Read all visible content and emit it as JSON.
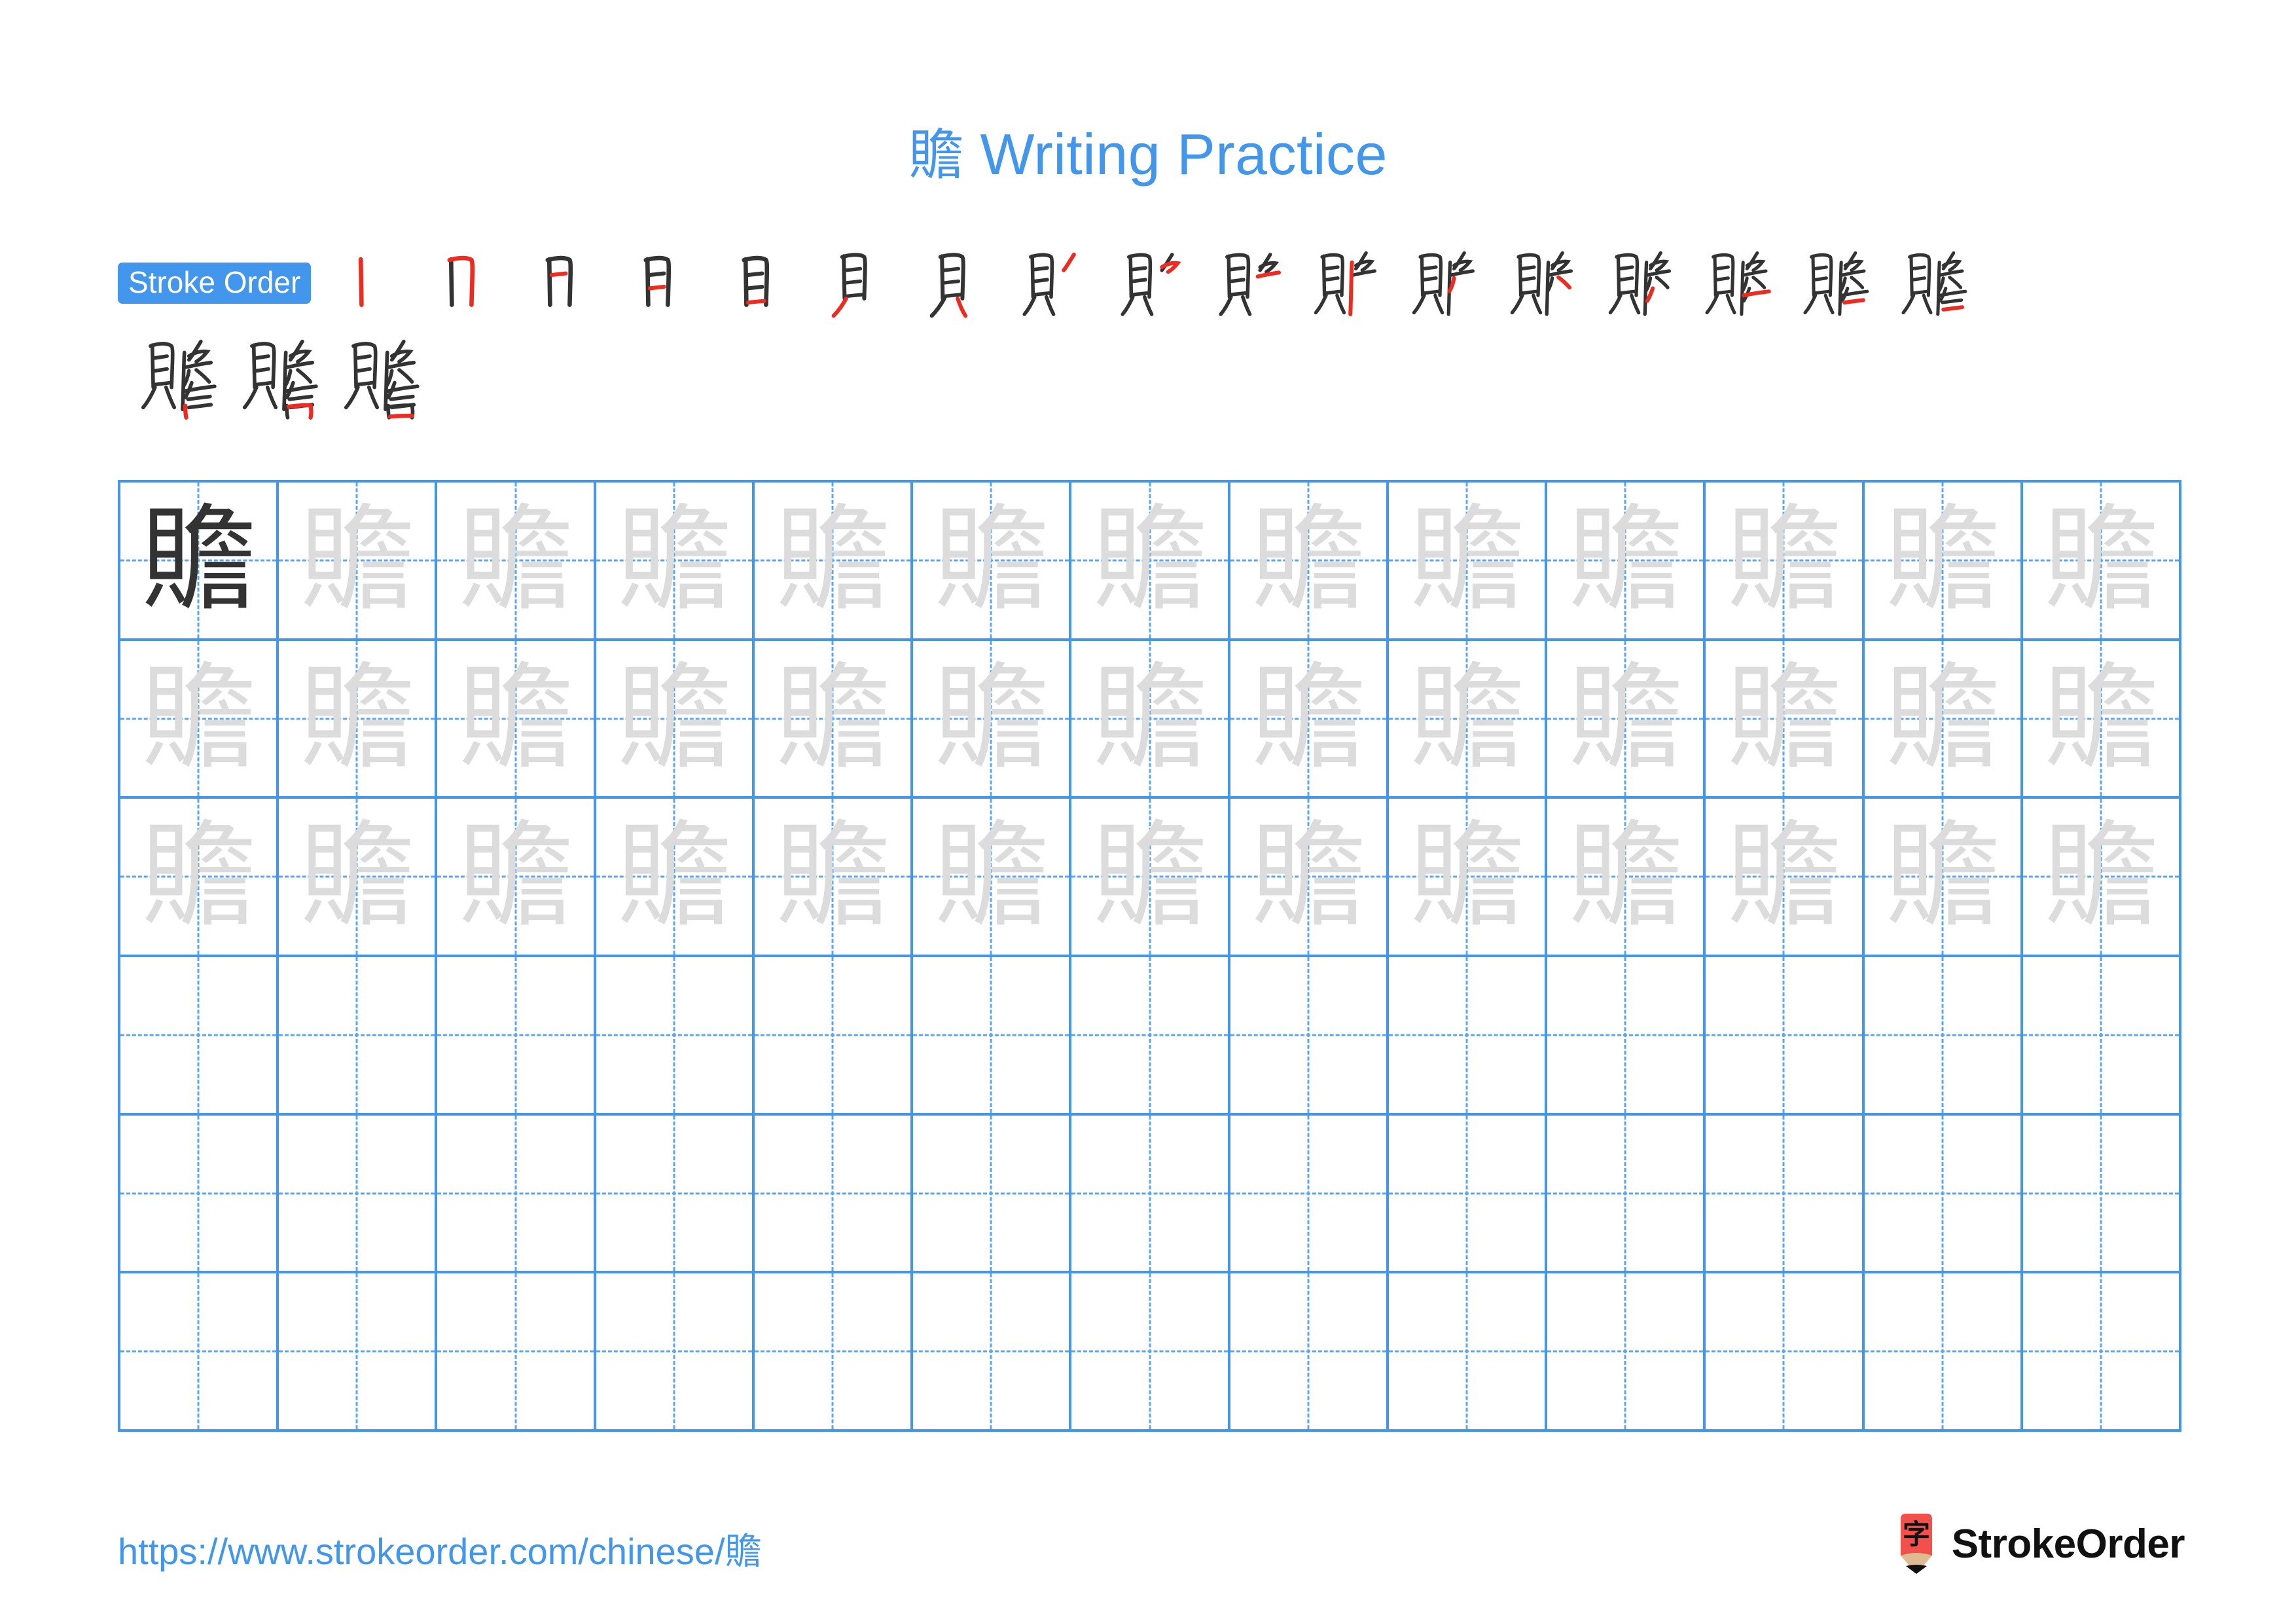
{
  "page": {
    "character": "贍",
    "background_color": "#ffffff",
    "accent_color": "#4296ec",
    "trace_gray": "#dcdcdc",
    "ink_dark": "#333333",
    "stroke_highlight_color": "#ee2b20",
    "logo_red": "#f2504b",
    "logo_tan": "#debb93"
  },
  "title": {
    "character": "贍",
    "text": " Writing Practice",
    "full": "贍 Writing Practice"
  },
  "stroke_order": {
    "badge_label": "Stroke Order",
    "total_strokes": 20,
    "row1_count": 17,
    "row2_count": 3,
    "steps": [
      {
        "index": 1,
        "glyph": "丨"
      },
      {
        "index": 2,
        "glyph": "冂"
      },
      {
        "index": 3,
        "glyph": "月"
      },
      {
        "index": 4,
        "glyph": "月"
      },
      {
        "index": 5,
        "glyph": "目"
      },
      {
        "index": 6,
        "glyph": "貝"
      },
      {
        "index": 7,
        "glyph": "貝"
      },
      {
        "index": 8,
        "glyph": "貝"
      },
      {
        "index": 9,
        "glyph": "貝"
      },
      {
        "index": 10,
        "glyph": "貝"
      },
      {
        "index": 11,
        "glyph": "貯"
      },
      {
        "index": 12,
        "glyph": "貯"
      },
      {
        "index": 13,
        "glyph": "貯"
      },
      {
        "index": 14,
        "glyph": "貯"
      },
      {
        "index": 15,
        "glyph": "贍"
      },
      {
        "index": 16,
        "glyph": "贍"
      },
      {
        "index": 17,
        "glyph": "贍"
      },
      {
        "index": 18,
        "glyph": "贍"
      },
      {
        "index": 19,
        "glyph": "贍"
      },
      {
        "index": 20,
        "glyph": "贍"
      }
    ]
  },
  "practice_grid": {
    "columns": 13,
    "rows": 6,
    "filled_rows": 3,
    "empty_rows": 3,
    "trace_character": "贍",
    "first_cell_is_dark": true
  },
  "footer": {
    "url_prefix": "https://www.strokeorder.com/chinese/",
    "url_character": "贍",
    "url": "https://www.strokeorder.com/chinese/贍",
    "brand_name": "StrokeOrder",
    "brand_logo_character": "字"
  }
}
